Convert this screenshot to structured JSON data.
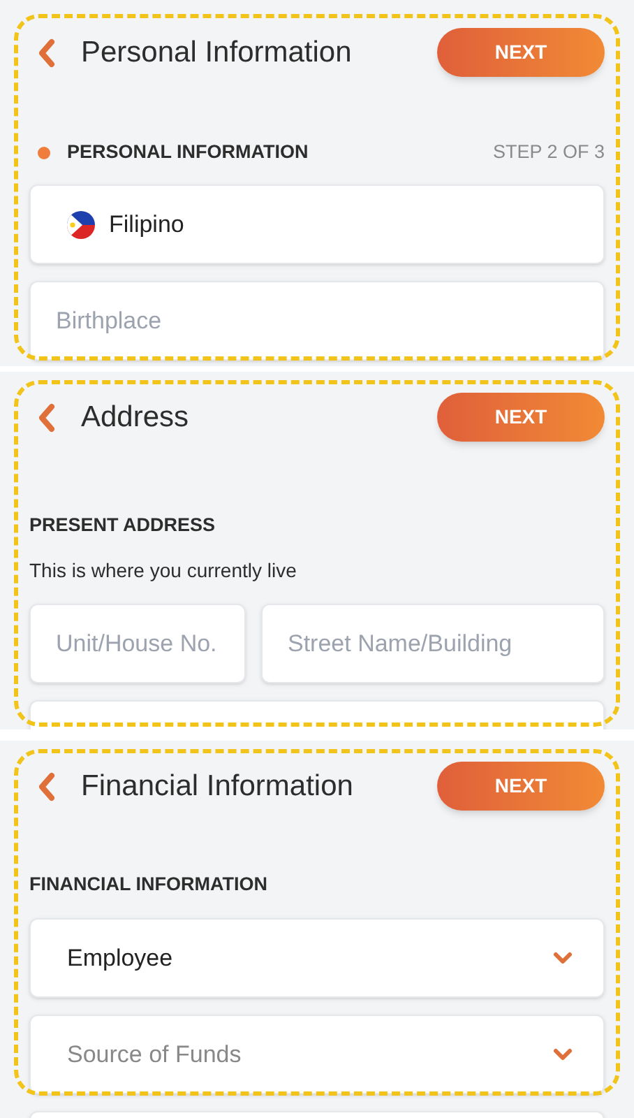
{
  "screens": [
    {
      "title": "Personal Information",
      "next_button": "NEXT",
      "section": {
        "label": "PERSONAL INFORMATION",
        "dot": true,
        "step": "STEP 2 OF 3"
      },
      "rows": [
        [
          {
            "kind": "flag",
            "value": "Filipino"
          }
        ],
        [
          {
            "kind": "text",
            "placeholder": "Birthplace"
          }
        ]
      ]
    },
    {
      "title": "Address",
      "next_button": "NEXT",
      "section": {
        "label": "PRESENT ADDRESS",
        "dot": false,
        "subtitle": "This is where you currently live"
      },
      "rows": [
        [
          {
            "kind": "text",
            "placeholder": "Unit/House No."
          },
          {
            "kind": "text",
            "placeholder": "Street Name/Building"
          }
        ],
        [
          {
            "kind": "text"
          }
        ]
      ]
    },
    {
      "title": "Financial Information",
      "next_button": "NEXT",
      "section": {
        "label": "FINANCIAL INFORMATION",
        "dot": false
      },
      "rows": [
        [
          {
            "kind": "select",
            "value": "Employee"
          }
        ],
        [
          {
            "kind": "select",
            "placeholder": "Source of Funds"
          }
        ],
        [
          {
            "kind": "text"
          }
        ]
      ]
    }
  ]
}
